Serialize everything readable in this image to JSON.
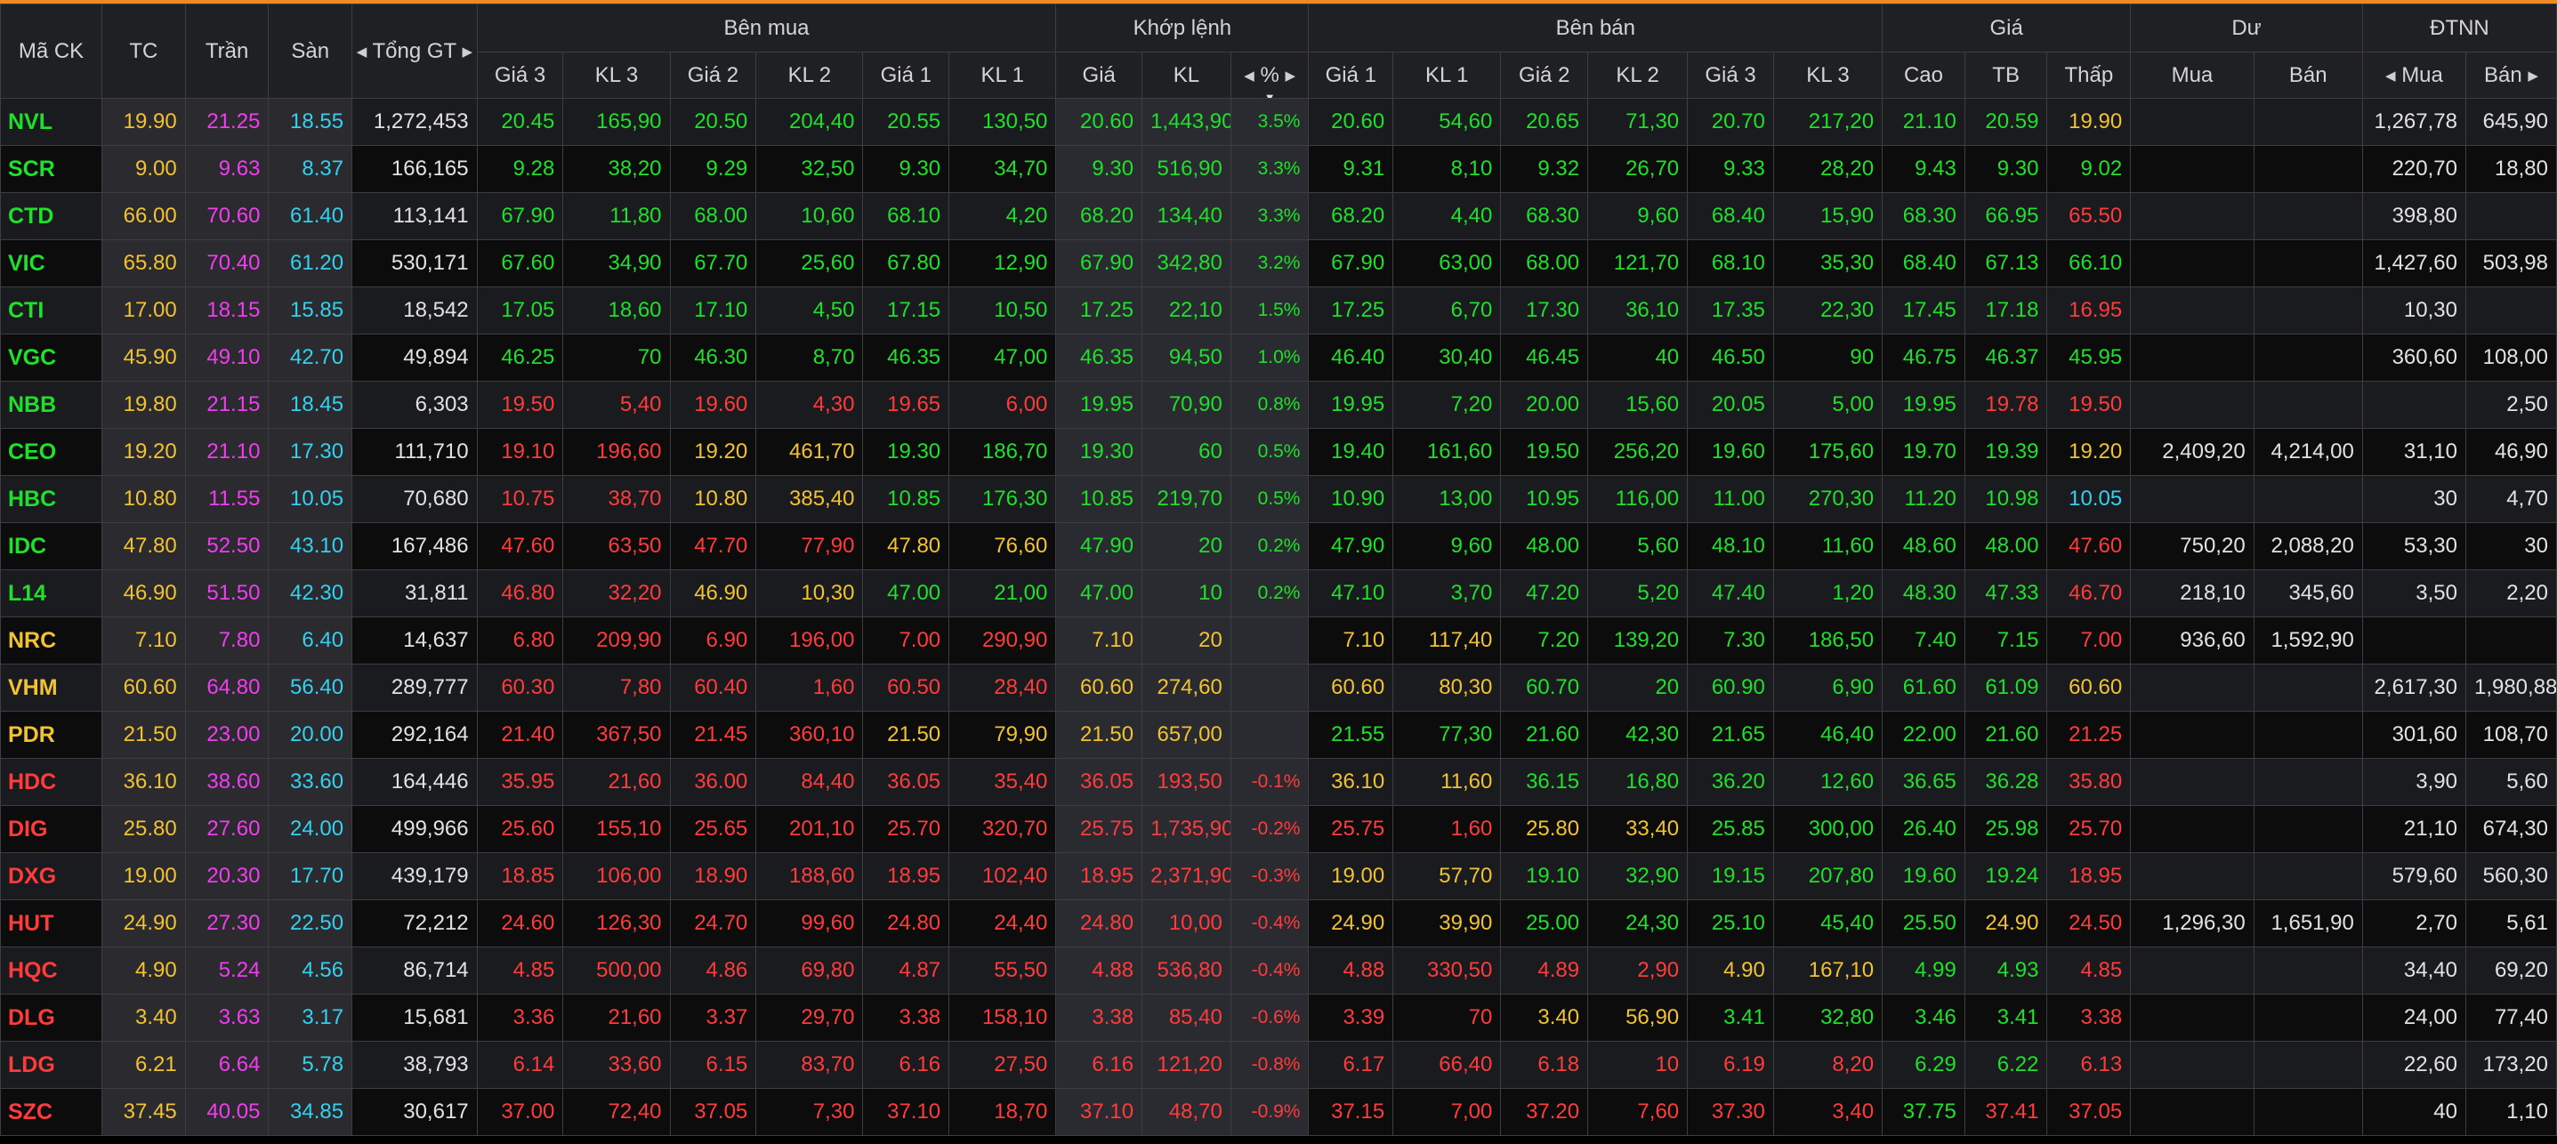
{
  "header": {
    "symbol": "Mã CK",
    "ref": "TC",
    "ceiling": "Trần",
    "floor": "Sàn",
    "total_value": "Tổng GT",
    "buy_group": "Bên mua",
    "match_group": "Khớp lệnh",
    "sell_group": "Bên bán",
    "price_group": "Giá",
    "remain_group": "Dư",
    "foreign_group": "ĐTNN",
    "buy_cols": [
      "Giá 3",
      "KL 3",
      "Giá 2",
      "KL 2",
      "Giá 1",
      "KL 1"
    ],
    "match_cols": [
      "Giá",
      "KL",
      "%"
    ],
    "sell_cols": [
      "Giá 1",
      "KL 1",
      "Giá 2",
      "KL 2",
      "Giá 3",
      "KL 3"
    ],
    "price_cols": [
      "Cao",
      "TB",
      "Thấp"
    ],
    "remain_cols": [
      "Mua",
      "Bán"
    ],
    "foreign_cols": [
      "Mua",
      "Bán"
    ]
  },
  "icons": {
    "left": "caret-left-icon",
    "right": "caret-right-icon",
    "sort": "sort-down-icon"
  },
  "colors": {
    "up": "#1fe02a",
    "down": "#ff3b3b",
    "ref": "#f2c230",
    "ceiling": "#f13cf1",
    "floor": "#33d0f0",
    "accent": "#f08a24"
  },
  "rows": [
    {
      "sym": "NVL",
      "ref": "19.90",
      "ceil": "21.25",
      "floor": "18.55",
      "tv": "1,272,453",
      "b": [
        [
          "20.45",
          "165,90"
        ],
        [
          "20.50",
          "204,40"
        ],
        [
          "20.55",
          "130,50"
        ]
      ],
      "m": [
        "20.60",
        "1,443,90",
        "3.5%"
      ],
      "s": [
        [
          "20.60",
          "54,60"
        ],
        [
          "20.65",
          "71,30"
        ],
        [
          "20.70",
          "217,20"
        ]
      ],
      "hi": "21.10",
      "avg": "20.59",
      "lo": "19.90",
      "rb": "",
      "rs": "",
      "fb": "1,267,78",
      "fs": "645,90"
    },
    {
      "sym": "SCR",
      "ref": "9.00",
      "ceil": "9.63",
      "floor": "8.37",
      "tv": "166,165",
      "b": [
        [
          "9.28",
          "38,20"
        ],
        [
          "9.29",
          "32,50"
        ],
        [
          "9.30",
          "34,70"
        ]
      ],
      "m": [
        "9.30",
        "516,90",
        "3.3%"
      ],
      "s": [
        [
          "9.31",
          "8,10"
        ],
        [
          "9.32",
          "26,70"
        ],
        [
          "9.33",
          "28,20"
        ]
      ],
      "hi": "9.43",
      "avg": "9.30",
      "lo": "9.02",
      "rb": "",
      "rs": "",
      "fb": "220,70",
      "fs": "18,80"
    },
    {
      "sym": "CTD",
      "ref": "66.00",
      "ceil": "70.60",
      "floor": "61.40",
      "tv": "113,141",
      "b": [
        [
          "67.90",
          "11,80"
        ],
        [
          "68.00",
          "10,60"
        ],
        [
          "68.10",
          "4,20"
        ]
      ],
      "m": [
        "68.20",
        "134,40",
        "3.3%"
      ],
      "s": [
        [
          "68.20",
          "4,40"
        ],
        [
          "68.30",
          "9,60"
        ],
        [
          "68.40",
          "15,90"
        ]
      ],
      "hi": "68.30",
      "avg": "66.95",
      "lo": "65.50",
      "rb": "",
      "rs": "",
      "fb": "398,80",
      "fs": ""
    },
    {
      "sym": "VIC",
      "ref": "65.80",
      "ceil": "70.40",
      "floor": "61.20",
      "tv": "530,171",
      "b": [
        [
          "67.60",
          "34,90"
        ],
        [
          "67.70",
          "25,60"
        ],
        [
          "67.80",
          "12,90"
        ]
      ],
      "m": [
        "67.90",
        "342,80",
        "3.2%"
      ],
      "s": [
        [
          "67.90",
          "63,00"
        ],
        [
          "68.00",
          "121,70"
        ],
        [
          "68.10",
          "35,30"
        ]
      ],
      "hi": "68.40",
      "avg": "67.13",
      "lo": "66.10",
      "rb": "",
      "rs": "",
      "fb": "1,427,60",
      "fs": "503,98"
    },
    {
      "sym": "CTI",
      "ref": "17.00",
      "ceil": "18.15",
      "floor": "15.85",
      "tv": "18,542",
      "b": [
        [
          "17.05",
          "18,60"
        ],
        [
          "17.10",
          "4,50"
        ],
        [
          "17.15",
          "10,50"
        ]
      ],
      "m": [
        "17.25",
        "22,10",
        "1.5%"
      ],
      "s": [
        [
          "17.25",
          "6,70"
        ],
        [
          "17.30",
          "36,10"
        ],
        [
          "17.35",
          "22,30"
        ]
      ],
      "hi": "17.45",
      "avg": "17.18",
      "lo": "16.95",
      "rb": "",
      "rs": "",
      "fb": "10,30",
      "fs": ""
    },
    {
      "sym": "VGC",
      "ref": "45.90",
      "ceil": "49.10",
      "floor": "42.70",
      "tv": "49,894",
      "b": [
        [
          "46.25",
          "70"
        ],
        [
          "46.30",
          "8,70"
        ],
        [
          "46.35",
          "47,00"
        ]
      ],
      "m": [
        "46.35",
        "94,50",
        "1.0%"
      ],
      "s": [
        [
          "46.40",
          "30,40"
        ],
        [
          "46.45",
          "40"
        ],
        [
          "46.50",
          "90"
        ]
      ],
      "hi": "46.75",
      "avg": "46.37",
      "lo": "45.95",
      "rb": "",
      "rs": "",
      "fb": "360,60",
      "fs": "108,00"
    },
    {
      "sym": "NBB",
      "ref": "19.80",
      "ceil": "21.15",
      "floor": "18.45",
      "tv": "6,303",
      "b": [
        [
          "19.50",
          "5,40"
        ],
        [
          "19.60",
          "4,30"
        ],
        [
          "19.65",
          "6,00"
        ]
      ],
      "m": [
        "19.95",
        "70,90",
        "0.8%"
      ],
      "s": [
        [
          "19.95",
          "7,20"
        ],
        [
          "20.00",
          "15,60"
        ],
        [
          "20.05",
          "5,00"
        ]
      ],
      "hi": "19.95",
      "avg": "19.78",
      "lo": "19.50",
      "rb": "",
      "rs": "",
      "fb": "",
      "fs": "2,50"
    },
    {
      "sym": "CEO",
      "ref": "19.20",
      "ceil": "21.10",
      "floor": "17.30",
      "tv": "111,710",
      "b": [
        [
          "19.10",
          "196,60"
        ],
        [
          "19.20",
          "461,70"
        ],
        [
          "19.30",
          "186,70"
        ]
      ],
      "m": [
        "19.30",
        "60",
        "0.5%"
      ],
      "s": [
        [
          "19.40",
          "161,60"
        ],
        [
          "19.50",
          "256,20"
        ],
        [
          "19.60",
          "175,60"
        ]
      ],
      "hi": "19.70",
      "avg": "19.39",
      "lo": "19.20",
      "rb": "2,409,20",
      "rs": "4,214,00",
      "fb": "31,10",
      "fs": "46,90"
    },
    {
      "sym": "HBC",
      "ref": "10.80",
      "ceil": "11.55",
      "floor": "10.05",
      "tv": "70,680",
      "b": [
        [
          "10.75",
          "38,70"
        ],
        [
          "10.80",
          "385,40"
        ],
        [
          "10.85",
          "176,30"
        ]
      ],
      "m": [
        "10.85",
        "219,70",
        "0.5%"
      ],
      "s": [
        [
          "10.90",
          "13,00"
        ],
        [
          "10.95",
          "116,00"
        ],
        [
          "11.00",
          "270,30"
        ]
      ],
      "hi": "11.20",
      "avg": "10.98",
      "lo": "10.05",
      "rb": "",
      "rs": "",
      "fb": "30",
      "fs": "4,70"
    },
    {
      "sym": "IDC",
      "ref": "47.80",
      "ceil": "52.50",
      "floor": "43.10",
      "tv": "167,486",
      "b": [
        [
          "47.60",
          "63,50"
        ],
        [
          "47.70",
          "77,90"
        ],
        [
          "47.80",
          "76,60"
        ]
      ],
      "m": [
        "47.90",
        "20",
        "0.2%"
      ],
      "s": [
        [
          "47.90",
          "9,60"
        ],
        [
          "48.00",
          "5,60"
        ],
        [
          "48.10",
          "11,60"
        ]
      ],
      "hi": "48.60",
      "avg": "48.00",
      "lo": "47.60",
      "rb": "750,20",
      "rs": "2,088,20",
      "fb": "53,30",
      "fs": "30"
    },
    {
      "sym": "L14",
      "ref": "46.90",
      "ceil": "51.50",
      "floor": "42.30",
      "tv": "31,811",
      "b": [
        [
          "46.80",
          "32,20"
        ],
        [
          "46.90",
          "10,30"
        ],
        [
          "47.00",
          "21,00"
        ]
      ],
      "m": [
        "47.00",
        "10",
        "0.2%"
      ],
      "s": [
        [
          "47.10",
          "3,70"
        ],
        [
          "47.20",
          "5,20"
        ],
        [
          "47.40",
          "1,20"
        ]
      ],
      "hi": "48.30",
      "avg": "47.33",
      "lo": "46.70",
      "rb": "218,10",
      "rs": "345,60",
      "fb": "3,50",
      "fs": "2,20"
    },
    {
      "sym": "NRC",
      "ref": "7.10",
      "ceil": "7.80",
      "floor": "6.40",
      "tv": "14,637",
      "b": [
        [
          "6.80",
          "209,90"
        ],
        [
          "6.90",
          "196,00"
        ],
        [
          "7.00",
          "290,90"
        ]
      ],
      "m": [
        "7.10",
        "20",
        ""
      ],
      "s": [
        [
          "7.10",
          "117,40"
        ],
        [
          "7.20",
          "139,20"
        ],
        [
          "7.30",
          "186,50"
        ]
      ],
      "hi": "7.40",
      "avg": "7.15",
      "lo": "7.00",
      "rb": "936,60",
      "rs": "1,592,90",
      "fb": "",
      "fs": ""
    },
    {
      "sym": "VHM",
      "ref": "60.60",
      "ceil": "64.80",
      "floor": "56.40",
      "tv": "289,777",
      "b": [
        [
          "60.30",
          "7,80"
        ],
        [
          "60.40",
          "1,60"
        ],
        [
          "60.50",
          "28,40"
        ]
      ],
      "m": [
        "60.60",
        "274,60",
        ""
      ],
      "s": [
        [
          "60.60",
          "80,30"
        ],
        [
          "60.70",
          "20"
        ],
        [
          "60.90",
          "6,90"
        ]
      ],
      "hi": "61.60",
      "avg": "61.09",
      "lo": "60.60",
      "rb": "",
      "rs": "",
      "fb": "2,617,30",
      "fs": "1,980,88"
    },
    {
      "sym": "PDR",
      "ref": "21.50",
      "ceil": "23.00",
      "floor": "20.00",
      "tv": "292,164",
      "b": [
        [
          "21.40",
          "367,50"
        ],
        [
          "21.45",
          "360,10"
        ],
        [
          "21.50",
          "79,90"
        ]
      ],
      "m": [
        "21.50",
        "657,00",
        ""
      ],
      "s": [
        [
          "21.55",
          "77,30"
        ],
        [
          "21.60",
          "42,30"
        ],
        [
          "21.65",
          "46,40"
        ]
      ],
      "hi": "22.00",
      "avg": "21.60",
      "lo": "21.25",
      "rb": "",
      "rs": "",
      "fb": "301,60",
      "fs": "108,70"
    },
    {
      "sym": "HDC",
      "ref": "36.10",
      "ceil": "38.60",
      "floor": "33.60",
      "tv": "164,446",
      "b": [
        [
          "35.95",
          "21,60"
        ],
        [
          "36.00",
          "84,40"
        ],
        [
          "36.05",
          "35,40"
        ]
      ],
      "m": [
        "36.05",
        "193,50",
        "-0.1%"
      ],
      "s": [
        [
          "36.10",
          "11,60"
        ],
        [
          "36.15",
          "16,80"
        ],
        [
          "36.20",
          "12,60"
        ]
      ],
      "hi": "36.65",
      "avg": "36.28",
      "lo": "35.80",
      "rb": "",
      "rs": "",
      "fb": "3,90",
      "fs": "5,60"
    },
    {
      "sym": "DIG",
      "ref": "25.80",
      "ceil": "27.60",
      "floor": "24.00",
      "tv": "499,966",
      "b": [
        [
          "25.60",
          "155,10"
        ],
        [
          "25.65",
          "201,10"
        ],
        [
          "25.70",
          "320,70"
        ]
      ],
      "m": [
        "25.75",
        "1,735,90",
        "-0.2%"
      ],
      "s": [
        [
          "25.75",
          "1,60"
        ],
        [
          "25.80",
          "33,40"
        ],
        [
          "25.85",
          "300,00"
        ]
      ],
      "hi": "26.40",
      "avg": "25.98",
      "lo": "25.70",
      "rb": "",
      "rs": "",
      "fb": "21,10",
      "fs": "674,30"
    },
    {
      "sym": "DXG",
      "ref": "19.00",
      "ceil": "20.30",
      "floor": "17.70",
      "tv": "439,179",
      "b": [
        [
          "18.85",
          "106,00"
        ],
        [
          "18.90",
          "188,60"
        ],
        [
          "18.95",
          "102,40"
        ]
      ],
      "m": [
        "18.95",
        "2,371,90",
        "-0.3%"
      ],
      "s": [
        [
          "19.00",
          "57,70"
        ],
        [
          "19.10",
          "32,90"
        ],
        [
          "19.15",
          "207,80"
        ]
      ],
      "hi": "19.60",
      "avg": "19.24",
      "lo": "18.95",
      "rb": "",
      "rs": "",
      "fb": "579,60",
      "fs": "560,30"
    },
    {
      "sym": "HUT",
      "ref": "24.90",
      "ceil": "27.30",
      "floor": "22.50",
      "tv": "72,212",
      "b": [
        [
          "24.60",
          "126,30"
        ],
        [
          "24.70",
          "99,60"
        ],
        [
          "24.80",
          "24,40"
        ]
      ],
      "m": [
        "24.80",
        "10,00",
        "-0.4%"
      ],
      "s": [
        [
          "24.90",
          "39,90"
        ],
        [
          "25.00",
          "24,30"
        ],
        [
          "25.10",
          "45,40"
        ]
      ],
      "hi": "25.50",
      "avg": "24.90",
      "lo": "24.50",
      "rb": "1,296,30",
      "rs": "1,651,90",
      "fb": "2,70",
      "fs": "5,61"
    },
    {
      "sym": "HQC",
      "ref": "4.90",
      "ceil": "5.24",
      "floor": "4.56",
      "tv": "86,714",
      "b": [
        [
          "4.85",
          "500,00"
        ],
        [
          "4.86",
          "69,80"
        ],
        [
          "4.87",
          "55,50"
        ]
      ],
      "m": [
        "4.88",
        "536,80",
        "-0.4%"
      ],
      "s": [
        [
          "4.88",
          "330,50"
        ],
        [
          "4.89",
          "2,90"
        ],
        [
          "4.90",
          "167,10"
        ]
      ],
      "hi": "4.99",
      "avg": "4.93",
      "lo": "4.85",
      "rb": "",
      "rs": "",
      "fb": "34,40",
      "fs": "69,20"
    },
    {
      "sym": "DLG",
      "ref": "3.40",
      "ceil": "3.63",
      "floor": "3.17",
      "tv": "15,681",
      "b": [
        [
          "3.36",
          "21,60"
        ],
        [
          "3.37",
          "29,70"
        ],
        [
          "3.38",
          "158,10"
        ]
      ],
      "m": [
        "3.38",
        "85,40",
        "-0.6%"
      ],
      "s": [
        [
          "3.39",
          "70"
        ],
        [
          "3.40",
          "56,90"
        ],
        [
          "3.41",
          "32,80"
        ]
      ],
      "hi": "3.46",
      "avg": "3.41",
      "lo": "3.38",
      "rb": "",
      "rs": "",
      "fb": "24,00",
      "fs": "77,40"
    },
    {
      "sym": "LDG",
      "ref": "6.21",
      "ceil": "6.64",
      "floor": "5.78",
      "tv": "38,793",
      "b": [
        [
          "6.14",
          "33,60"
        ],
        [
          "6.15",
          "83,70"
        ],
        [
          "6.16",
          "27,50"
        ]
      ],
      "m": [
        "6.16",
        "121,20",
        "-0.8%"
      ],
      "s": [
        [
          "6.17",
          "66,40"
        ],
        [
          "6.18",
          "10"
        ],
        [
          "6.19",
          "8,20"
        ]
      ],
      "hi": "6.29",
      "avg": "6.22",
      "lo": "6.13",
      "rb": "",
      "rs": "",
      "fb": "22,60",
      "fs": "173,20"
    },
    {
      "sym": "SZC",
      "ref": "37.45",
      "ceil": "40.05",
      "floor": "34.85",
      "tv": "30,617",
      "b": [
        [
          "37.00",
          "72,40"
        ],
        [
          "37.05",
          "7,30"
        ],
        [
          "37.10",
          "18,70"
        ]
      ],
      "m": [
        "37.10",
        "48,70",
        "-0.9%"
      ],
      "s": [
        [
          "37.15",
          "7,00"
        ],
        [
          "37.20",
          "7,60"
        ],
        [
          "37.30",
          "3,40"
        ]
      ],
      "hi": "37.75",
      "avg": "37.41",
      "lo": "37.05",
      "rb": "",
      "rs": "",
      "fb": "40",
      "fs": "1,10"
    }
  ]
}
